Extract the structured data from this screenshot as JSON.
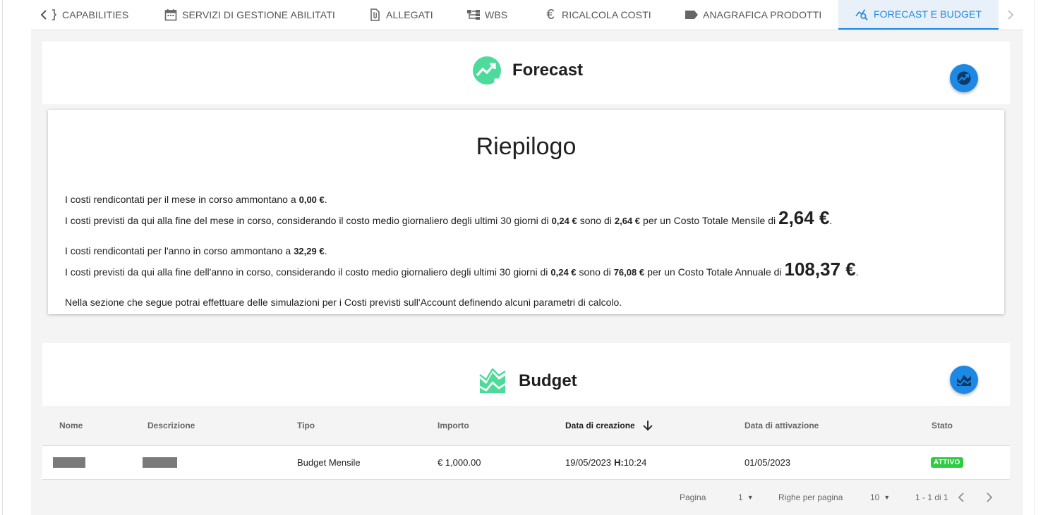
{
  "tabs": [
    {
      "label": "CAPABILITIES",
      "icon": "capabilities-icon"
    },
    {
      "label": "SERVIZI DI GESTIONE ABILITATI",
      "icon": "calendar-icon"
    },
    {
      "label": "ALLEGATI",
      "icon": "paperclip-icon"
    },
    {
      "label": "WBS",
      "icon": "hierarchy-icon"
    },
    {
      "label": "RICALCOLA COSTI",
      "icon": "euro-icon"
    },
    {
      "label": "ANAGRAFICA PRODOTTI",
      "icon": "tag-icon"
    },
    {
      "label": "FORECAST E BUDGET",
      "icon": "analytics-icon",
      "active": true
    }
  ],
  "forecast": {
    "title": "Forecast",
    "summary": {
      "title": "Riepilogo",
      "month_current": {
        "prefix": "I costi rendicontati per il mese in corso ammontano a",
        "value": "0,00 €",
        "suffix": "."
      },
      "month_forecast": {
        "prefix": "I costi previsti da qui alla fine del mese in corso, considerando il costo medio giornaliero degli ultimi 30 giorni di",
        "daily": "0,24 €",
        "mid": "sono di",
        "forecast": "2,64 €",
        "total_label": "per un Costo Totale Mensile di",
        "total": "2,64 €",
        "suffix": "."
      },
      "year_current": {
        "prefix": "I costi rendicontati per l'anno in corso ammontano a",
        "value": "32,29 €",
        "suffix": "."
      },
      "year_forecast": {
        "prefix": "I costi previsti da qui alla fine dell'anno in corso, considerando il costo medio giornaliero degli ultimi 30 giorni di",
        "daily": "0,24 €",
        "mid": "sono di",
        "forecast": "76,08 €",
        "total_label": "per un Costo Totale Annuale di",
        "total": "108,37 €",
        "suffix": "."
      },
      "note": "Nella sezione che segue potrai effettuare delle simulazioni per i Costi previsti sull'Account definendo alcuni parametri di calcolo."
    }
  },
  "budget": {
    "title": "Budget",
    "columns": [
      "Nome",
      "Descrizione",
      "Tipo",
      "Importo",
      "Data di creazione",
      "Data di attivazione",
      "Stato"
    ],
    "rows": [
      {
        "nome": "",
        "descrizione": "",
        "tipo": "Budget Mensile",
        "importo": "€ 1,000.00",
        "data_creazione": "19/05/2023",
        "ora_label": "H:",
        "ora": "10:24",
        "data_attivazione": "01/05/2023",
        "stato": "ATTIVO"
      }
    ],
    "pagination": {
      "page_label": "Pagina",
      "page": "1",
      "rows_label": "Righe per pagina",
      "rows_per_page": "10",
      "range": "1 - 1 di 1"
    }
  },
  "colors": {
    "accent": "#1e88e5",
    "brand_green": "#4ddb9b",
    "status_active": "#2ecc40"
  }
}
